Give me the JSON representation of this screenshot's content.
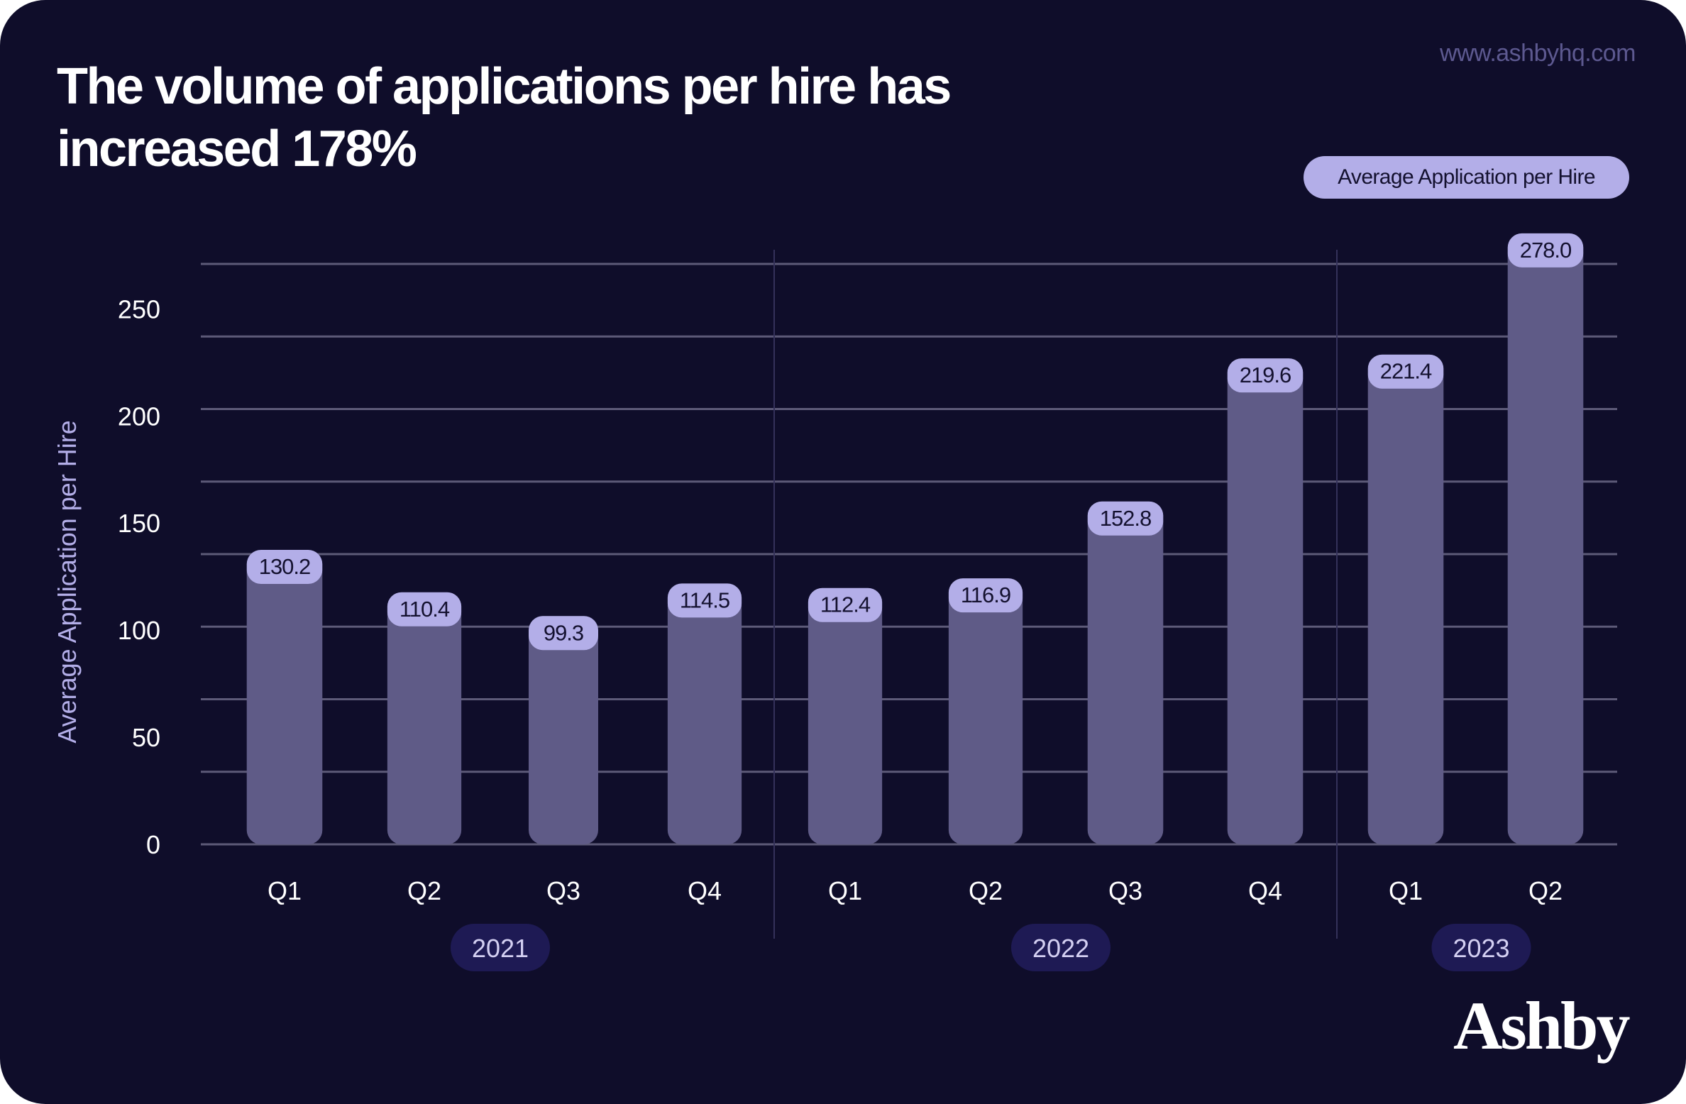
{
  "header": {
    "title": "The volume of applications per hire has increased 178%",
    "url": "www.ashbyhq.com"
  },
  "brand": {
    "logo_text": "Ashby"
  },
  "colors": {
    "background": "#0f0d2a",
    "bar": "#5f5b87",
    "value_pill": "#b3aee8",
    "year_pill": "#1e1a54",
    "gridline": "#5d5a78",
    "axis_title": "#b3aee8",
    "url": "#5d5990"
  },
  "chart_data": {
    "type": "bar",
    "title": "The volume of applications per hire has increased 178%",
    "xlabel": "",
    "ylabel": "Average Application per Hire",
    "legend": {
      "entries": [
        "Average Application per Hire"
      ],
      "placement": "top-right"
    },
    "ylim": [
      0,
      271
    ],
    "yticks": [
      0,
      50,
      100,
      150,
      200,
      250
    ],
    "grid": true,
    "categories": [
      "Q1",
      "Q2",
      "Q3",
      "Q4",
      "Q1",
      "Q2",
      "Q3",
      "Q4",
      "Q1",
      "Q2"
    ],
    "groups": [
      {
        "label": "2021",
        "count": 4
      },
      {
        "label": "2022",
        "count": 4
      },
      {
        "label": "2023",
        "count": 2
      }
    ],
    "series": [
      {
        "name": "Average Application per Hire",
        "values": [
          130.2,
          110.4,
          99.3,
          114.5,
          112.4,
          116.9,
          152.8,
          219.6,
          221.4,
          278.0
        ],
        "labels": [
          "130.2",
          "110.4",
          "99.3",
          "114.5",
          "112.4",
          "116.9",
          "152.8",
          "219.6",
          "221.4",
          "278.0"
        ]
      }
    ]
  }
}
